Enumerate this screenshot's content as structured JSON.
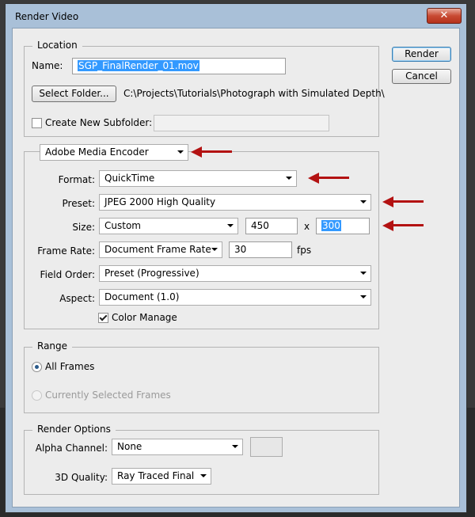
{
  "window": {
    "title": "Render Video",
    "close_symbol": "✕"
  },
  "location": {
    "group_label": "Location",
    "name_label": "Name:",
    "name_value": "SGP_FinalRender_01.mov",
    "select_folder_label": "Select Folder...",
    "folder_path": "C:\\Projects\\Tutorials\\Photograph with Simulated Depth\\",
    "create_subfolder_label": "Create New Subfolder:",
    "create_subfolder_checked": false,
    "subfolder_value": ""
  },
  "encoder": {
    "selected": "Adobe Media Encoder",
    "format_label": "Format:",
    "format_value": "QuickTime",
    "preset_label": "Preset:",
    "preset_value": "JPEG 2000 High Quality",
    "size_label": "Size:",
    "size_value": "Custom",
    "width": "450",
    "size_x": "x",
    "height": "300",
    "frame_rate_label": "Frame Rate:",
    "frame_rate_value": "Document Frame Rate",
    "fps_value": "30",
    "fps_unit": "fps",
    "field_order_label": "Field Order:",
    "field_order_value": "Preset (Progressive)",
    "aspect_label": "Aspect:",
    "aspect_value": "Document (1.0)",
    "color_manage_label": "Color Manage",
    "color_manage_checked": true
  },
  "range": {
    "group_label": "Range",
    "all_frames_label": "All Frames",
    "selected_frames_label": "Currently Selected Frames",
    "selected": "All Frames"
  },
  "render_options": {
    "group_label": "Render Options",
    "alpha_label": "Alpha Channel:",
    "alpha_value": "None",
    "quality_label": "3D Quality:",
    "quality_value": "Ray Traced Final"
  },
  "buttons": {
    "render": "Render",
    "cancel": "Cancel"
  },
  "colors": {
    "annotation_arrow": "#b31212",
    "title_bar": "#a9c0d8",
    "dialog_bg": "#ececec",
    "selection": "#3399ff"
  }
}
